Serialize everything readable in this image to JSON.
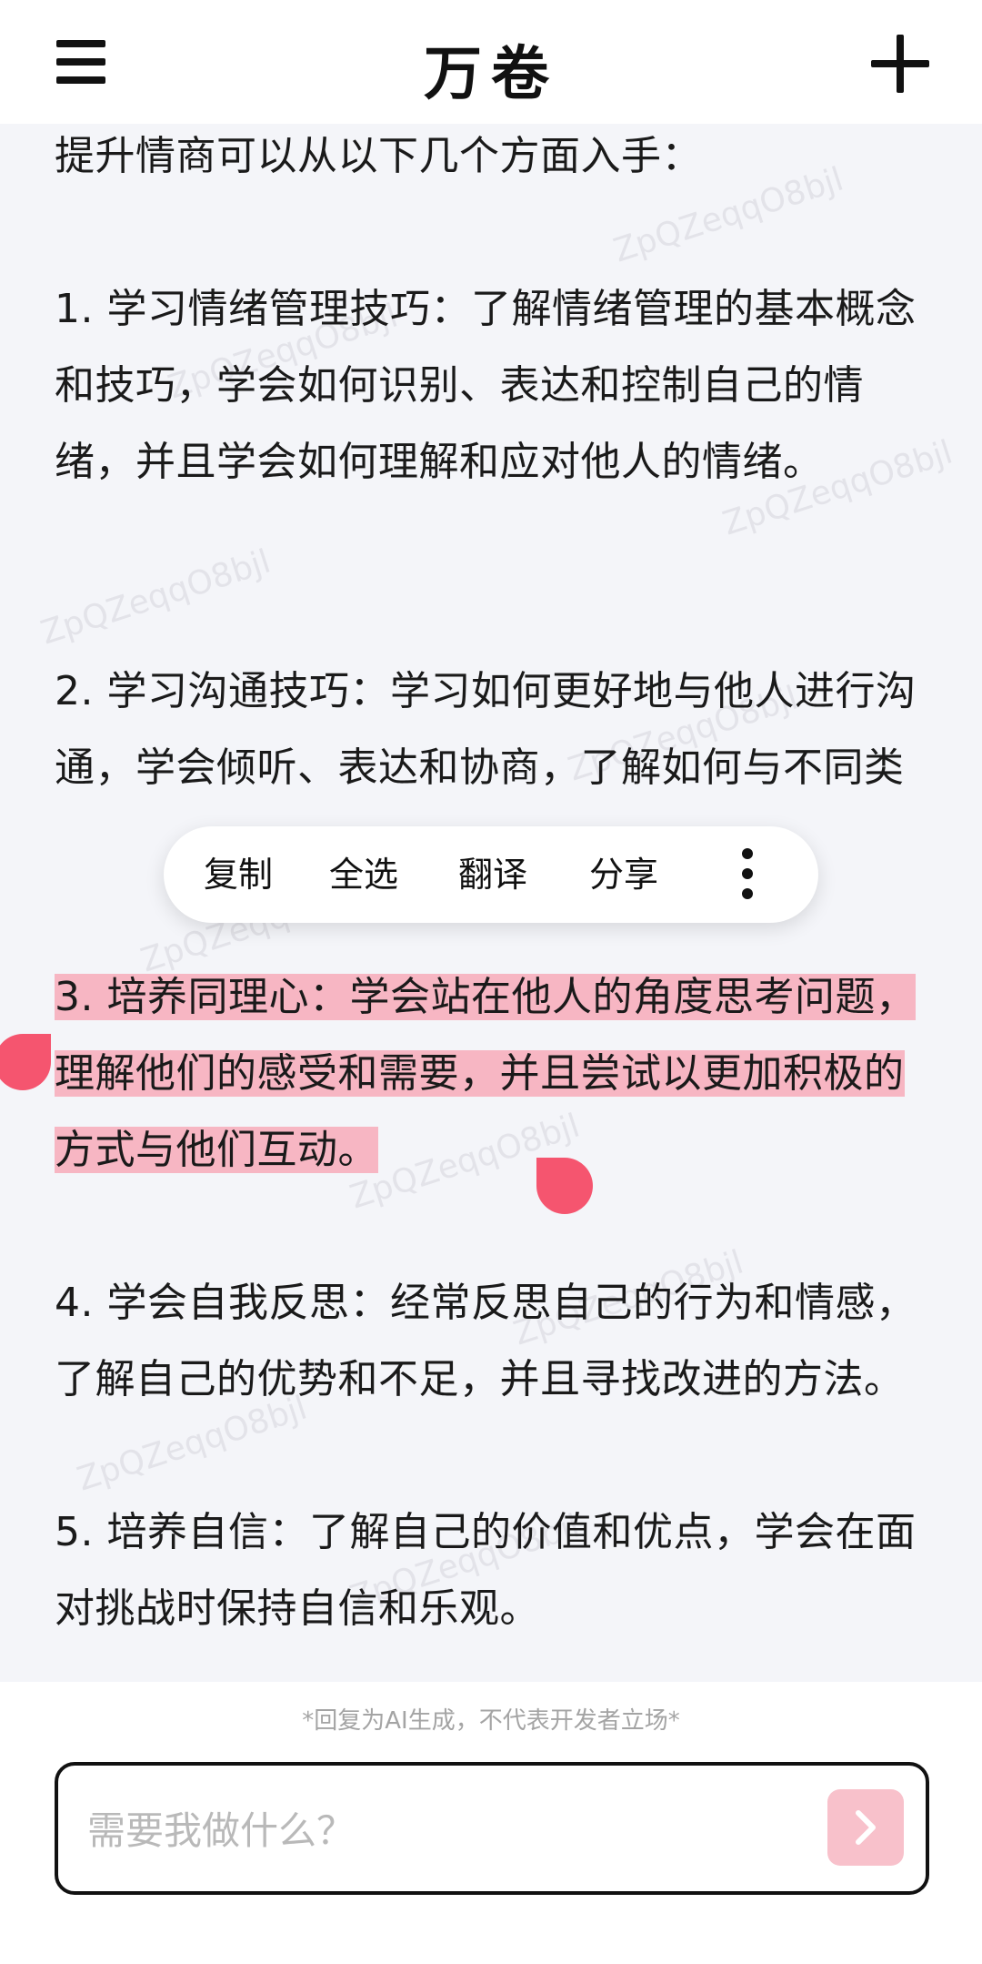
{
  "header": {
    "title": "万卷"
  },
  "content": {
    "intro": "提升情商可以从以下几个方面入手：",
    "items": [
      "1. 学习情绪管理技巧：了解情绪管理的基本概念和技巧，学会如何识别、表达和控制自己的情绪，并且学会如何理解和应对他人的情绪。",
      "2. 学习沟通技巧：学习如何更好地与他人进行沟通，学会倾听、表达和协商，了解如何与不同类型的人进行有效的交流和沟通。",
      "3. 培养同理心：学会站在他人的角度思考问题，理解他们的感受和需要，并且尝试以更加积极的方式与他们互动。",
      "4. 学会自我反思：经常反思自己的行为和情感，了解自己的优势和不足，并且寻找改进的方法。",
      "5. 培养自信：了解自己的价值和优点，学会在面对挑战时保持自信和乐观。"
    ],
    "watermark": "ZpQZeqqO8bjl"
  },
  "context_menu": {
    "copy": "复制",
    "select_all": "全选",
    "translate": "翻译",
    "share": "分享"
  },
  "footer": {
    "disclaimer": "*回复为AI生成，不代表开发者立场*",
    "input_placeholder": "需要我做什么？"
  },
  "colors": {
    "highlight": "#f7b6c3",
    "handle": "#f5556f",
    "send_button": "#f8c1cb"
  }
}
